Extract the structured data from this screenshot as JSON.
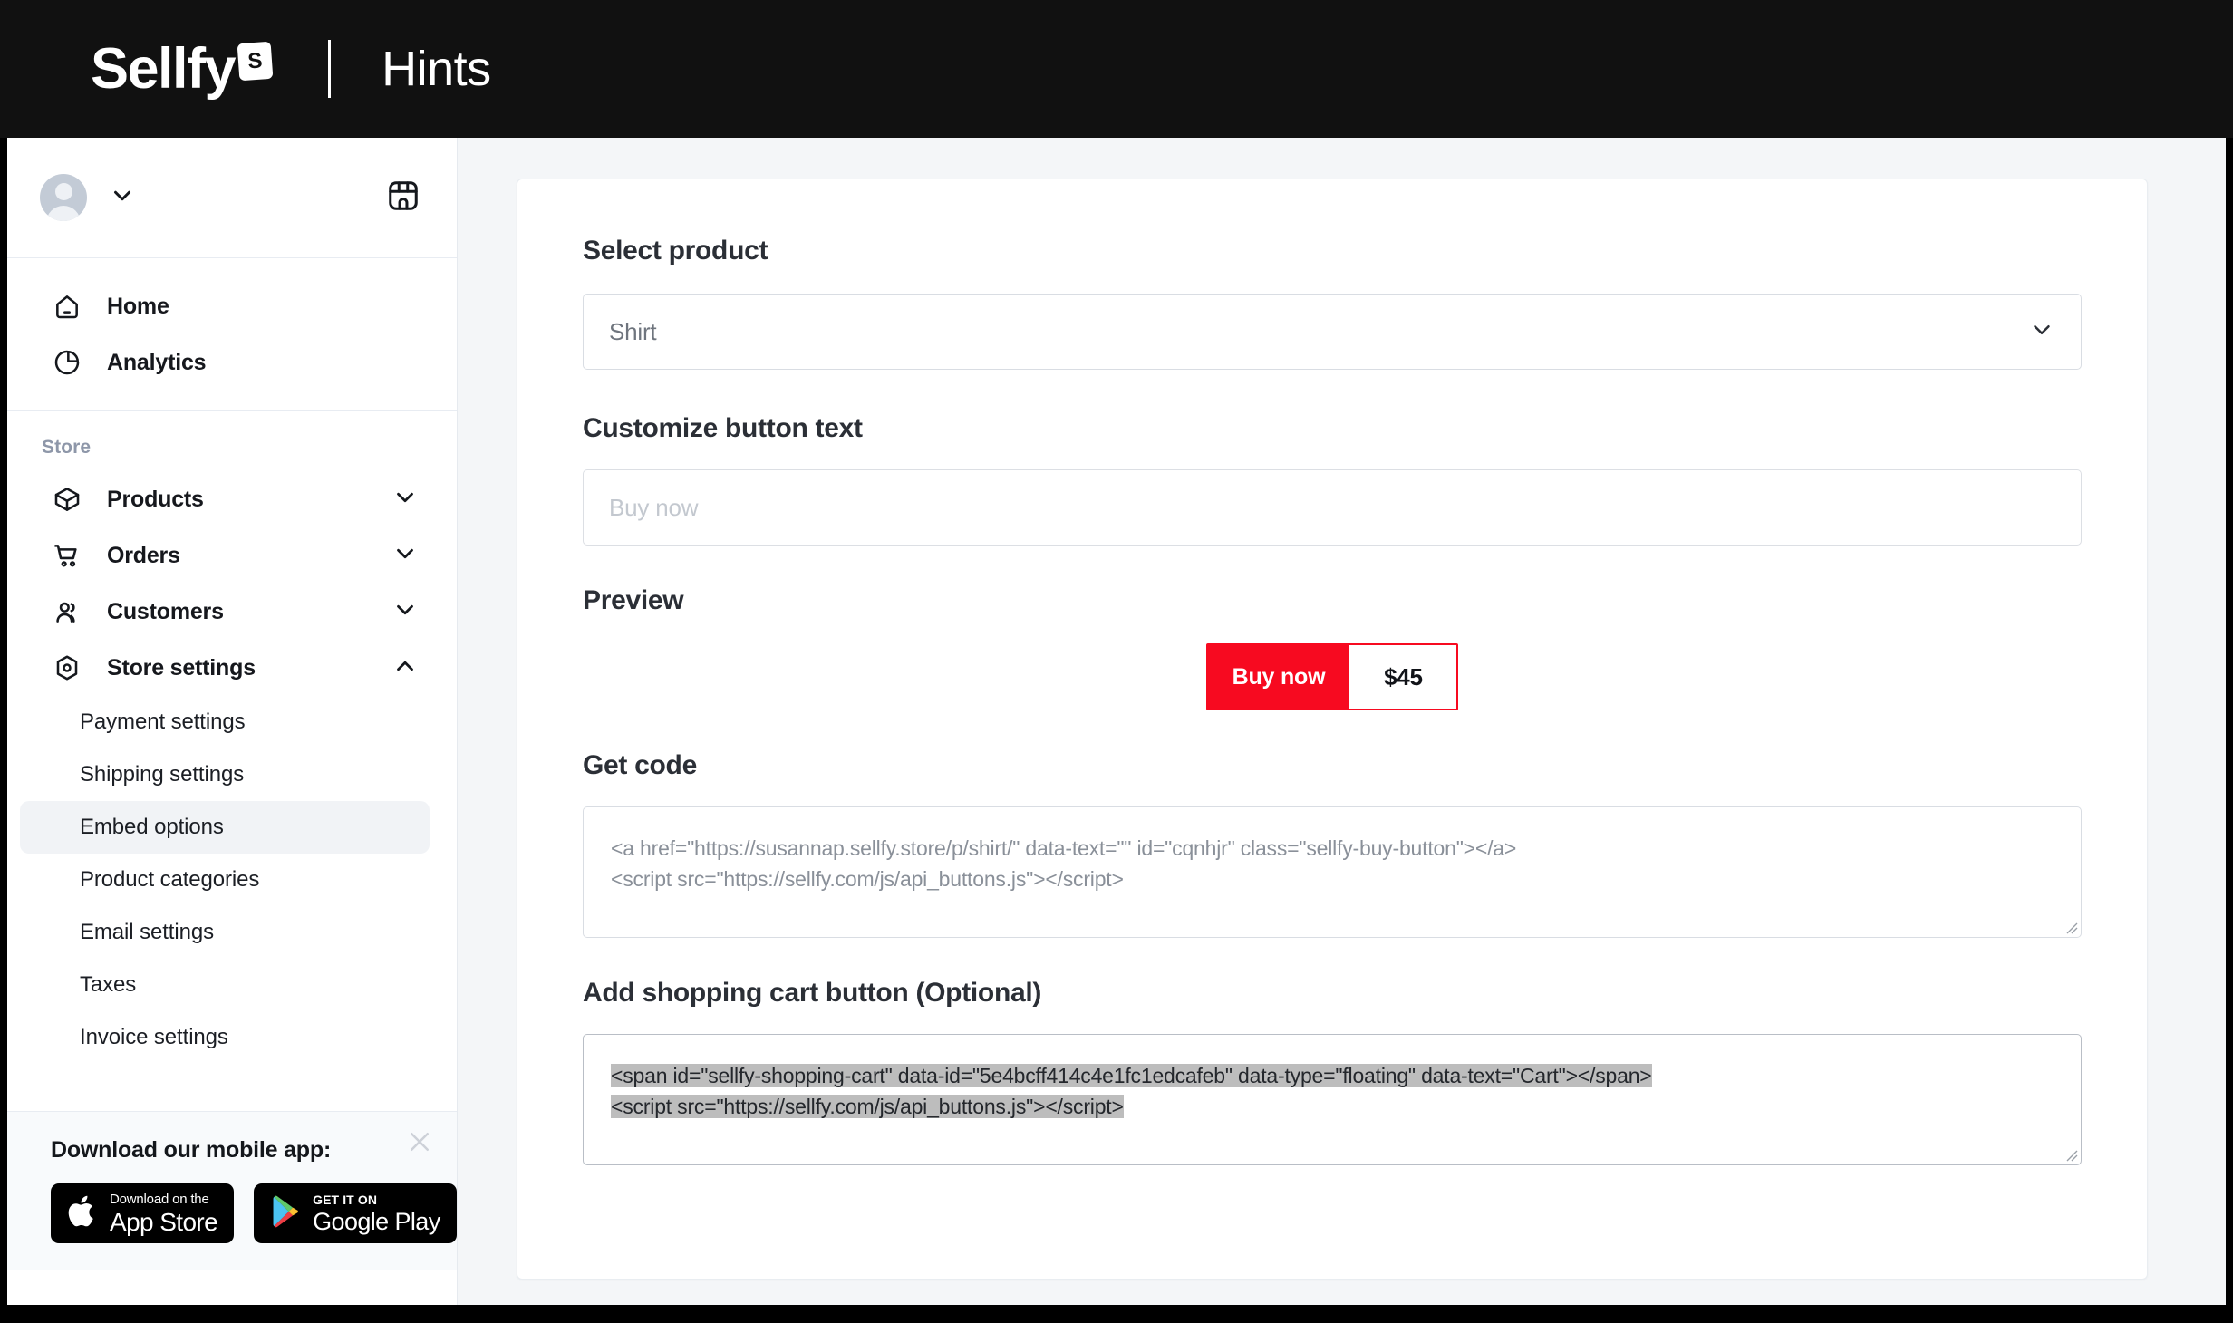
{
  "header": {
    "brand_name": "Sellfy",
    "brand_badge": "S",
    "page_title": "Hints"
  },
  "sidebar": {
    "profile": {
      "avatar_name": "user-avatar",
      "chevron": "chevron-down-icon"
    },
    "store_icon": "storefront-icon",
    "primary_items": [
      {
        "label": "Home",
        "icon": "home-icon"
      },
      {
        "label": "Analytics",
        "icon": "pie-chart-icon"
      }
    ],
    "section_label": "Store",
    "store_items": [
      {
        "label": "Products",
        "icon": "box-icon",
        "expanded": false
      },
      {
        "label": "Orders",
        "icon": "cart-icon",
        "expanded": false
      },
      {
        "label": "Customers",
        "icon": "people-icon",
        "expanded": false
      },
      {
        "label": "Store settings",
        "icon": "gear-icon",
        "expanded": true
      }
    ],
    "store_settings_subitems": [
      {
        "label": "Payment settings",
        "active": false
      },
      {
        "label": "Shipping settings",
        "active": false
      },
      {
        "label": "Embed options",
        "active": true
      },
      {
        "label": "Product categories",
        "active": false
      },
      {
        "label": "Email settings",
        "active": false
      },
      {
        "label": "Taxes",
        "active": false
      },
      {
        "label": "Invoice settings",
        "active": false
      }
    ],
    "promo": {
      "title": "Download our mobile app:",
      "close_icon": "close-icon",
      "appstore": {
        "sup": "Download on the",
        "main": "App Store",
        "icon": "apple-icon"
      },
      "googleplay": {
        "sup": "GET IT ON",
        "main": "Google Play",
        "icon": "google-play-icon"
      }
    }
  },
  "main": {
    "select_product": {
      "label": "Select product",
      "value": "Shirt",
      "chevron": "chevron-down-icon"
    },
    "customize_button": {
      "label": "Customize button text",
      "value": "",
      "placeholder": "Buy now"
    },
    "preview": {
      "label": "Preview",
      "button_text": "Buy now",
      "price": "$45",
      "accent_color": "#f70a20"
    },
    "get_code": {
      "label": "Get code",
      "line1": "<a href=\"https://susannap.sellfy.store/p/shirt/\" data-text=\"\" id=\"cqnhjr\" class=\"sellfy-buy-button\"></a>",
      "line2": "<script src=\"https://sellfy.com/js/api_buttons.js\"></script>"
    },
    "cart_code": {
      "label": "Add shopping cart button (Optional)",
      "line1": "<span id=\"sellfy-shopping-cart\" data-id=\"5e4bcff414c4e1fc1edcafeb\" data-type=\"floating\" data-text=\"Cart\"></span>",
      "line2": "<script src=\"https://sellfy.com/js/api_buttons.js\"></script>",
      "selected": true
    }
  }
}
